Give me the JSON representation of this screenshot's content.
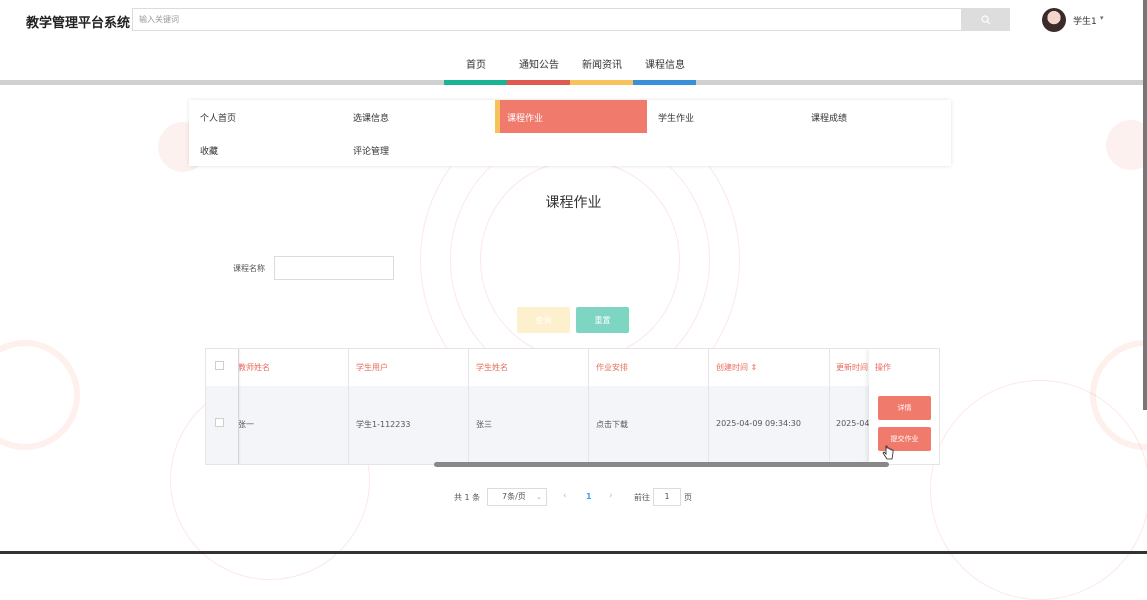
{
  "header": {
    "logo": "教学管理平台系统",
    "search_placeholder": "输入关键词",
    "user_name": "学生1"
  },
  "nav": {
    "items": [
      "首页",
      "通知公告",
      "新闻资讯",
      "课程信息"
    ],
    "colors": [
      "#1ab394",
      "#e05a4f",
      "#f6c35c",
      "#3a8fd9"
    ]
  },
  "submenu": {
    "items": [
      "个人首页",
      "选课信息",
      "课程作业",
      "学生作业",
      "课程成绩",
      "收藏",
      "评论管理"
    ],
    "active": "课程作业",
    "accent_color": "#f07a6c"
  },
  "page_title": "课程作业",
  "form": {
    "course_label": "课程名称",
    "query_btn": "查询",
    "reset_btn": "重置"
  },
  "table": {
    "headers": [
      "教师姓名",
      "学生用户",
      "学生姓名",
      "作业安排",
      "创建时间 ⇕",
      "更新时间",
      "操作"
    ],
    "row": {
      "teacher": "张一",
      "student_user": "学生1-112233",
      "student_name": "张三",
      "homework": "点击下载",
      "created": "2025-04-09 09:34:30",
      "updated": "2025-04"
    },
    "ops": [
      "详情",
      "提交作业"
    ]
  },
  "pagination": {
    "total": "共 1 条",
    "page_size": "7条/页",
    "current": "1",
    "goto_label": "前往",
    "goto_value": "1",
    "page_unit": "页"
  }
}
